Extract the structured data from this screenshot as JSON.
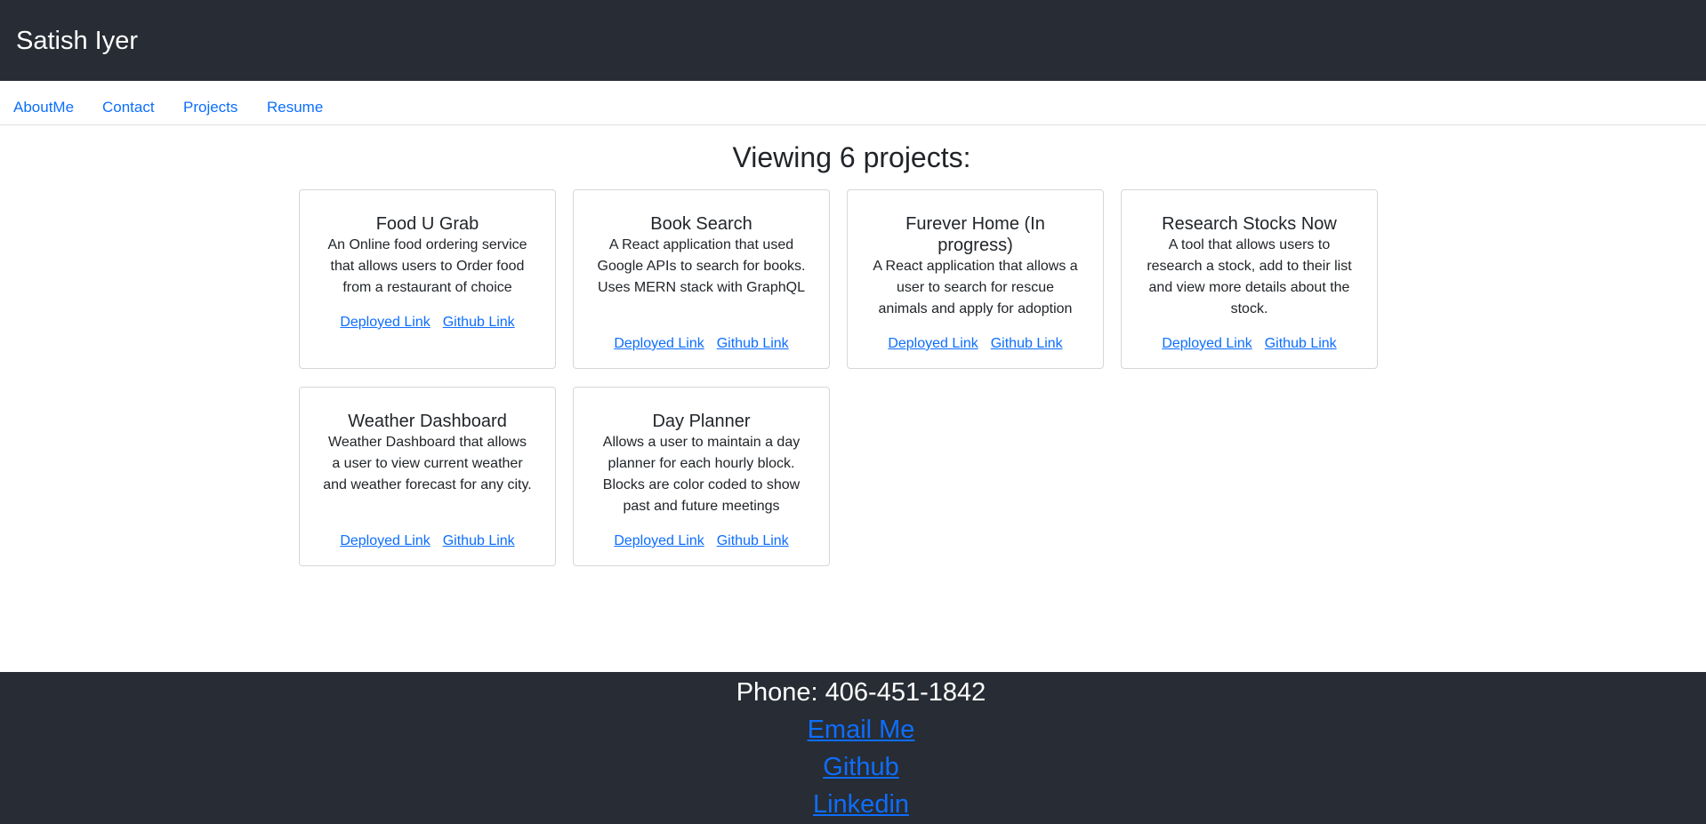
{
  "header": {
    "title": "Satish Iyer"
  },
  "nav": {
    "items": [
      "AboutMe",
      "Contact",
      "Projects",
      "Resume"
    ]
  },
  "main": {
    "heading": "Viewing 6 projects:"
  },
  "projects": [
    {
      "title": "Food U Grab",
      "description": "An Online food ordering service that allows users to Order food from a restaurant of choice",
      "deployed_label": "Deployed Link",
      "github_label": "Github Link"
    },
    {
      "title": "Book Search",
      "description": "A React application that used Google APIs to search for books. Uses MERN stack with GraphQL",
      "deployed_label": "Deployed Link",
      "github_label": "Github Link"
    },
    {
      "title": "Furever Home (In progress)",
      "description": "A React application that allows a user to search for rescue animals and apply for adoption",
      "deployed_label": "Deployed Link",
      "github_label": "Github Link"
    },
    {
      "title": "Research Stocks Now",
      "description": "A tool that allows users to research a stock, add to their list and view more details about the stock.",
      "deployed_label": "Deployed Link",
      "github_label": "Github Link"
    },
    {
      "title": "Weather Dashboard",
      "description": "Weather Dashboard that allows a user to view current weather and weather forecast for any city.",
      "deployed_label": "Deployed Link",
      "github_label": "Github Link"
    },
    {
      "title": "Day Planner",
      "description": "Allows a user to maintain a day planner for each hourly block. Blocks are color coded to show past and future meetings",
      "deployed_label": "Deployed Link",
      "github_label": "Github Link"
    }
  ],
  "footer": {
    "phone": "Phone: 406-451-1842",
    "email_label": "Email Me",
    "github_label": "Github",
    "linkedin_label": "Linkedin"
  },
  "colors": {
    "header_bg": "#282c34",
    "link": "#0d6efd",
    "text": "#212529"
  }
}
